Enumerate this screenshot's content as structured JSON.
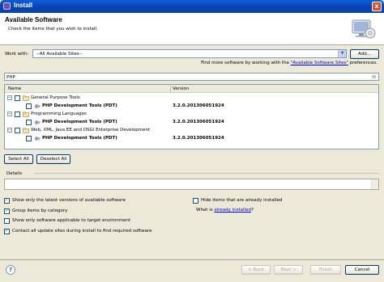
{
  "window": {
    "title": "Install",
    "close_label": "x"
  },
  "header": {
    "title": "Available Software",
    "description": "Check the items that you wish to install."
  },
  "work_with": {
    "label": "Work with:",
    "value": "--All Available Sites--",
    "add_label": "Add...",
    "more_prefix": "Find more software by working with the ",
    "more_link": "\"Available Software Sites\"",
    "more_suffix": " preferences."
  },
  "filter": {
    "value": "PHP"
  },
  "table": {
    "columns": [
      "Name",
      "Version"
    ],
    "rows": [
      {
        "name": "General Purpose Tools",
        "version": "",
        "level": 0
      },
      {
        "name": "PHP Development Tools (PDT)",
        "version": "3.2.0.201306051924",
        "level": 1
      },
      {
        "name": "Programming Languages",
        "version": "",
        "level": 0
      },
      {
        "name": "PHP Development Tools (PDT)",
        "version": "3.2.0.201306051924",
        "level": 1
      },
      {
        "name": "Web, XML, Java EE and OSGi Enterprise Development",
        "version": "",
        "level": 0
      },
      {
        "name": "PHP Development Tools (PDT)",
        "version": "3.2.0.201306051924",
        "level": 1
      }
    ]
  },
  "buttons": {
    "select_all": "Select All",
    "deselect_all": "Deselect All",
    "back": "< Back",
    "next": "Next >",
    "finish": "Finish",
    "cancel": "Cancel"
  },
  "details": {
    "label": "Details"
  },
  "options": {
    "latest_versions": {
      "label": "Show only the latest versions of available software",
      "checked": true
    },
    "group_by_category": {
      "label": "Group items by category",
      "checked": true
    },
    "target_env": {
      "label": "Show only software applicable to target environment",
      "checked": false
    },
    "contact_sites": {
      "label": "Contact all update sites during install to find required software",
      "checked": true
    },
    "hide_installed": {
      "label": "Hide items that are already installed",
      "checked": false
    },
    "what_is_prefix": "What is ",
    "what_is_link": "already installed",
    "what_is_suffix": "?"
  },
  "help": {
    "glyph": "?"
  }
}
